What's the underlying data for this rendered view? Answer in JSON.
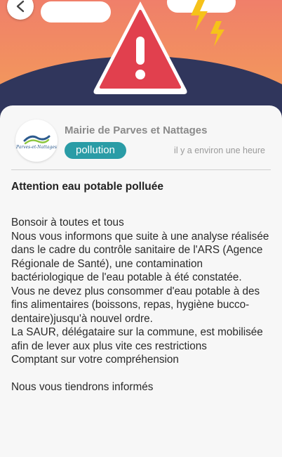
{
  "header": {
    "back_icon": "chevron-left-icon",
    "alert_icon": "warning-triangle-icon",
    "decor_icon": "lightning-bolt-icon",
    "colors": {
      "sky_top": "#f07f6a",
      "sky_bottom": "#f3a25c",
      "hill": "#30365c",
      "warning_red": "#e1404e"
    }
  },
  "notification": {
    "logo_text": "Parves-et-Nattages",
    "sender": "Mairie de Parves et Nattages",
    "category": "pollution",
    "category_color": "#2a9ca6",
    "time": "il y a environ une heure",
    "title": "Attention eau potable polluée",
    "body": "Bonsoir à toutes et tous\nNous vous informons que suite à une analyse réalisée dans le cadre du contrôle sanitaire de l'ARS (Agence Régionale de Santé), une contamination bactériologique de l'eau potable à été constatée.\nVous ne devez plus consommer d'eau potable à des fins alimentaires (boissons, repas, hygiène bucco-dentaire)jusqu'à nouvel ordre.\nLa SAUR, délégataire sur la commune, est mobilisée afin de lever aux plus vite ces restrictions\nComptant sur votre compréhension\n\nNous vous tiendrons informés"
  }
}
